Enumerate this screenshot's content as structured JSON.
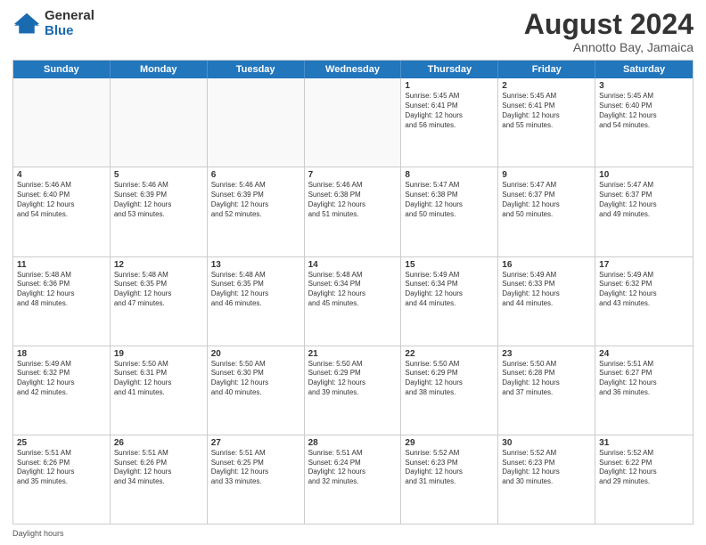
{
  "logo": {
    "general": "General",
    "blue": "Blue"
  },
  "title": {
    "month": "August 2024",
    "location": "Annotto Bay, Jamaica"
  },
  "header_days": [
    "Sunday",
    "Monday",
    "Tuesday",
    "Wednesday",
    "Thursday",
    "Friday",
    "Saturday"
  ],
  "footer": "Daylight hours",
  "rows": [
    [
      {
        "day": "",
        "text": "",
        "empty": true
      },
      {
        "day": "",
        "text": "",
        "empty": true
      },
      {
        "day": "",
        "text": "",
        "empty": true
      },
      {
        "day": "",
        "text": "",
        "empty": true
      },
      {
        "day": "1",
        "text": "Sunrise: 5:45 AM\nSunset: 6:41 PM\nDaylight: 12 hours\nand 56 minutes.",
        "empty": false
      },
      {
        "day": "2",
        "text": "Sunrise: 5:45 AM\nSunset: 6:41 PM\nDaylight: 12 hours\nand 55 minutes.",
        "empty": false
      },
      {
        "day": "3",
        "text": "Sunrise: 5:45 AM\nSunset: 6:40 PM\nDaylight: 12 hours\nand 54 minutes.",
        "empty": false
      }
    ],
    [
      {
        "day": "4",
        "text": "Sunrise: 5:46 AM\nSunset: 6:40 PM\nDaylight: 12 hours\nand 54 minutes.",
        "empty": false
      },
      {
        "day": "5",
        "text": "Sunrise: 5:46 AM\nSunset: 6:39 PM\nDaylight: 12 hours\nand 53 minutes.",
        "empty": false
      },
      {
        "day": "6",
        "text": "Sunrise: 5:46 AM\nSunset: 6:39 PM\nDaylight: 12 hours\nand 52 minutes.",
        "empty": false
      },
      {
        "day": "7",
        "text": "Sunrise: 5:46 AM\nSunset: 6:38 PM\nDaylight: 12 hours\nand 51 minutes.",
        "empty": false
      },
      {
        "day": "8",
        "text": "Sunrise: 5:47 AM\nSunset: 6:38 PM\nDaylight: 12 hours\nand 50 minutes.",
        "empty": false
      },
      {
        "day": "9",
        "text": "Sunrise: 5:47 AM\nSunset: 6:37 PM\nDaylight: 12 hours\nand 50 minutes.",
        "empty": false
      },
      {
        "day": "10",
        "text": "Sunrise: 5:47 AM\nSunset: 6:37 PM\nDaylight: 12 hours\nand 49 minutes.",
        "empty": false
      }
    ],
    [
      {
        "day": "11",
        "text": "Sunrise: 5:48 AM\nSunset: 6:36 PM\nDaylight: 12 hours\nand 48 minutes.",
        "empty": false
      },
      {
        "day": "12",
        "text": "Sunrise: 5:48 AM\nSunset: 6:35 PM\nDaylight: 12 hours\nand 47 minutes.",
        "empty": false
      },
      {
        "day": "13",
        "text": "Sunrise: 5:48 AM\nSunset: 6:35 PM\nDaylight: 12 hours\nand 46 minutes.",
        "empty": false
      },
      {
        "day": "14",
        "text": "Sunrise: 5:48 AM\nSunset: 6:34 PM\nDaylight: 12 hours\nand 45 minutes.",
        "empty": false
      },
      {
        "day": "15",
        "text": "Sunrise: 5:49 AM\nSunset: 6:34 PM\nDaylight: 12 hours\nand 44 minutes.",
        "empty": false
      },
      {
        "day": "16",
        "text": "Sunrise: 5:49 AM\nSunset: 6:33 PM\nDaylight: 12 hours\nand 44 minutes.",
        "empty": false
      },
      {
        "day": "17",
        "text": "Sunrise: 5:49 AM\nSunset: 6:32 PM\nDaylight: 12 hours\nand 43 minutes.",
        "empty": false
      }
    ],
    [
      {
        "day": "18",
        "text": "Sunrise: 5:49 AM\nSunset: 6:32 PM\nDaylight: 12 hours\nand 42 minutes.",
        "empty": false
      },
      {
        "day": "19",
        "text": "Sunrise: 5:50 AM\nSunset: 6:31 PM\nDaylight: 12 hours\nand 41 minutes.",
        "empty": false
      },
      {
        "day": "20",
        "text": "Sunrise: 5:50 AM\nSunset: 6:30 PM\nDaylight: 12 hours\nand 40 minutes.",
        "empty": false
      },
      {
        "day": "21",
        "text": "Sunrise: 5:50 AM\nSunset: 6:29 PM\nDaylight: 12 hours\nand 39 minutes.",
        "empty": false
      },
      {
        "day": "22",
        "text": "Sunrise: 5:50 AM\nSunset: 6:29 PM\nDaylight: 12 hours\nand 38 minutes.",
        "empty": false
      },
      {
        "day": "23",
        "text": "Sunrise: 5:50 AM\nSunset: 6:28 PM\nDaylight: 12 hours\nand 37 minutes.",
        "empty": false
      },
      {
        "day": "24",
        "text": "Sunrise: 5:51 AM\nSunset: 6:27 PM\nDaylight: 12 hours\nand 36 minutes.",
        "empty": false
      }
    ],
    [
      {
        "day": "25",
        "text": "Sunrise: 5:51 AM\nSunset: 6:26 PM\nDaylight: 12 hours\nand 35 minutes.",
        "empty": false
      },
      {
        "day": "26",
        "text": "Sunrise: 5:51 AM\nSunset: 6:26 PM\nDaylight: 12 hours\nand 34 minutes.",
        "empty": false
      },
      {
        "day": "27",
        "text": "Sunrise: 5:51 AM\nSunset: 6:25 PM\nDaylight: 12 hours\nand 33 minutes.",
        "empty": false
      },
      {
        "day": "28",
        "text": "Sunrise: 5:51 AM\nSunset: 6:24 PM\nDaylight: 12 hours\nand 32 minutes.",
        "empty": false
      },
      {
        "day": "29",
        "text": "Sunrise: 5:52 AM\nSunset: 6:23 PM\nDaylight: 12 hours\nand 31 minutes.",
        "empty": false
      },
      {
        "day": "30",
        "text": "Sunrise: 5:52 AM\nSunset: 6:23 PM\nDaylight: 12 hours\nand 30 minutes.",
        "empty": false
      },
      {
        "day": "31",
        "text": "Sunrise: 5:52 AM\nSunset: 6:22 PM\nDaylight: 12 hours\nand 29 minutes.",
        "empty": false
      }
    ]
  ]
}
